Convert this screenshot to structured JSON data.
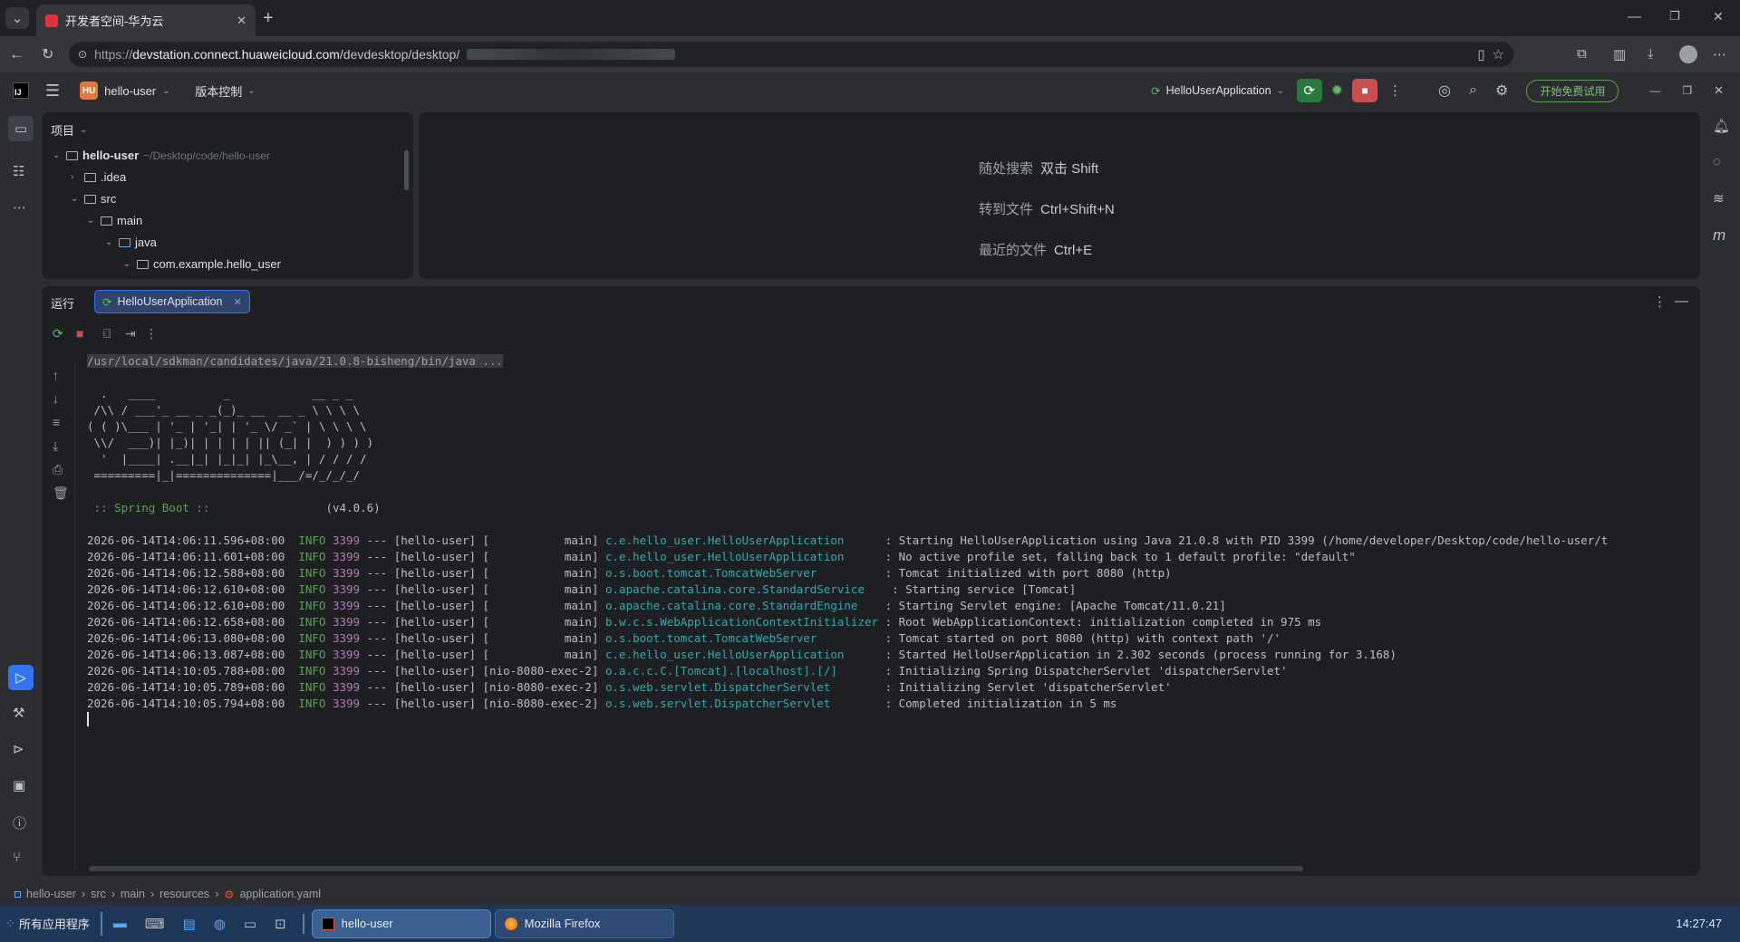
{
  "browser": {
    "tab_title": "开发者空间-华为云",
    "url_prefix": "https://",
    "url_host": "devstation.connect.huaweicloud.com",
    "url_path": "/devdesktop/desktop/"
  },
  "ide": {
    "project_badge": "HU",
    "project_name": "hello-user",
    "vcs_menu": "版本控制",
    "run_config": "HelloUserApplication",
    "trial_button": "开始免费试用",
    "project_panel_title": "项目",
    "tree": [
      {
        "label": "hello-user",
        "path": "~/Desktop/code/hello-user"
      },
      {
        "label": ".idea"
      },
      {
        "label": "src"
      },
      {
        "label": "main"
      },
      {
        "label": "java"
      },
      {
        "label": "com.example.hello_user"
      }
    ],
    "editor_hints": [
      {
        "label": "随处搜索",
        "shortcut": "双击 Shift"
      },
      {
        "label": "转到文件",
        "shortcut": "Ctrl+Shift+N"
      },
      {
        "label": "最近的文件",
        "shortcut": "Ctrl+E"
      }
    ],
    "run_panel_title": "运行",
    "run_tab_label": "HelloUserApplication",
    "console": {
      "cmdline": "/usr/local/sdkman/candidates/java/21.0.8-bisheng/bin/java ...",
      "banner": [
        "  .   ____          _            __ _ _",
        " /\\\\ / ___'_ __ _ _(_)_ __  __ _ \\ \\ \\ \\",
        "( ( )\\___ | '_ | '_| | '_ \\/ _` | \\ \\ \\ \\",
        " \\\\/  ___)| |_)| | | | | || (_| |  ) ) ) )",
        "  '  |____| .__|_| |_|_| |_\\__, | / / / /",
        " =========|_|==============|___/=/_/_/_/"
      ],
      "spring_label": " :: Spring Boot ::",
      "spring_version": "(v4.0.6)",
      "logs": [
        {
          "ts": "2026-06-14T14:06:11.596+08:00",
          "level": "INFO",
          "pid": "3399",
          "app": "--- [hello-user] [           main]",
          "logger": "c.e.hello_user.HelloUserApplication     ",
          "msg": ": Starting HelloUserApplication using Java 21.0.8 with PID 3399 (/home/developer/Desktop/code/hello-user/t"
        },
        {
          "ts": "2026-06-14T14:06:11.601+08:00",
          "level": "INFO",
          "pid": "3399",
          "app": "--- [hello-user] [           main]",
          "logger": "c.e.hello_user.HelloUserApplication     ",
          "msg": ": No active profile set, falling back to 1 default profile: \"default\""
        },
        {
          "ts": "2026-06-14T14:06:12.588+08:00",
          "level": "INFO",
          "pid": "3399",
          "app": "--- [hello-user] [           main]",
          "logger": "o.s.boot.tomcat.TomcatWebServer         ",
          "msg": ": Tomcat initialized with port 8080 (http)"
        },
        {
          "ts": "2026-06-14T14:06:12.610+08:00",
          "level": "INFO",
          "pid": "3399",
          "app": "--- [hello-user] [           main]",
          "logger": "o.apache.catalina.core.StandardService   ",
          "msg": ": Starting service [Tomcat]"
        },
        {
          "ts": "2026-06-14T14:06:12.610+08:00",
          "level": "INFO",
          "pid": "3399",
          "app": "--- [hello-user] [           main]",
          "logger": "o.apache.catalina.core.StandardEngine   ",
          "msg": ": Starting Servlet engine: [Apache Tomcat/11.0.21]"
        },
        {
          "ts": "2026-06-14T14:06:12.658+08:00",
          "level": "INFO",
          "pid": "3399",
          "app": "--- [hello-user] [           main]",
          "logger": "b.w.c.s.WebApplicationContextInitializer",
          "msg": ": Root WebApplicationContext: initialization completed in 975 ms"
        },
        {
          "ts": "2026-06-14T14:06:13.080+08:00",
          "level": "INFO",
          "pid": "3399",
          "app": "--- [hello-user] [           main]",
          "logger": "o.s.boot.tomcat.TomcatWebServer         ",
          "msg": ": Tomcat started on port 8080 (http) with context path '/'"
        },
        {
          "ts": "2026-06-14T14:06:13.087+08:00",
          "level": "INFO",
          "pid": "3399",
          "app": "--- [hello-user] [           main]",
          "logger": "c.e.hello_user.HelloUserApplication     ",
          "msg": ": Started HelloUserApplication in 2.302 seconds (process running for 3.168)"
        },
        {
          "ts": "2026-06-14T14:10:05.788+08:00",
          "level": "INFO",
          "pid": "3399",
          "app": "--- [hello-user] [nio-8080-exec-2]",
          "logger": "o.a.c.c.C.[Tomcat].[localhost].[/]      ",
          "msg": ": Initializing Spring DispatcherServlet 'dispatcherServlet'"
        },
        {
          "ts": "2026-06-14T14:10:05.789+08:00",
          "level": "INFO",
          "pid": "3399",
          "app": "--- [hello-user] [nio-8080-exec-2]",
          "logger": "o.s.web.servlet.DispatcherServlet       ",
          "msg": ": Initializing Servlet 'dispatcherServlet'"
        },
        {
          "ts": "2026-06-14T14:10:05.794+08:00",
          "level": "INFO",
          "pid": "3399",
          "app": "--- [hello-user] [nio-8080-exec-2]",
          "logger": "o.s.web.servlet.DispatcherServlet       ",
          "msg": ": Completed initialization in 5 ms"
        }
      ]
    },
    "breadcrumb": [
      "hello-user",
      "src",
      "main",
      "resources",
      "application.yaml"
    ]
  },
  "taskbar": {
    "start_label": "所有应用程序",
    "windows": [
      "hello-user",
      "Mozilla Firefox"
    ],
    "clock": "14:27:47"
  }
}
